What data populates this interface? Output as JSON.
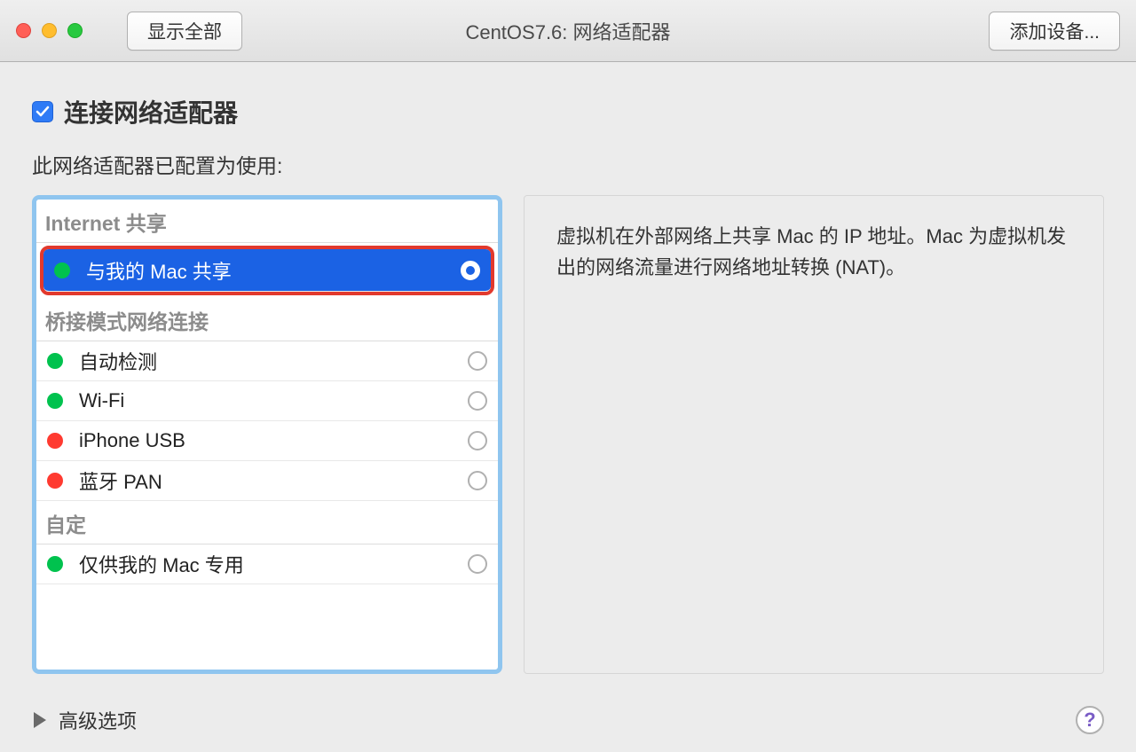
{
  "titlebar": {
    "show_all_label": "显示全部",
    "window_title": "CentOS7.6: 网络适配器",
    "add_device_label": "添加设备..."
  },
  "main": {
    "connect_checkbox_checked": true,
    "connect_label": "连接网络适配器",
    "config_label": "此网络适配器已配置为使用:",
    "description": "虚拟机在外部网络上共享 Mac 的 IP 地址。Mac 为虚拟机发出的网络流量进行网络地址转换 (NAT)。"
  },
  "groups": {
    "internet_sharing": "Internet 共享",
    "bridged": "桥接模式网络连接",
    "custom": "自定"
  },
  "options": {
    "share_mac": {
      "label": "与我的 Mac 共享",
      "status": "green",
      "selected": true
    },
    "autodetect": {
      "label": "自动检测",
      "status": "green",
      "selected": false
    },
    "wifi": {
      "label": "Wi-Fi",
      "status": "green",
      "selected": false
    },
    "iphone_usb": {
      "label": "iPhone USB",
      "status": "red",
      "selected": false
    },
    "bluetooth_pan": {
      "label": "蓝牙 PAN",
      "status": "red",
      "selected": false
    },
    "mac_only": {
      "label": "仅供我的 Mac 专用",
      "status": "green",
      "selected": false
    }
  },
  "footer": {
    "advanced_label": "高级选项",
    "help_label": "?"
  }
}
